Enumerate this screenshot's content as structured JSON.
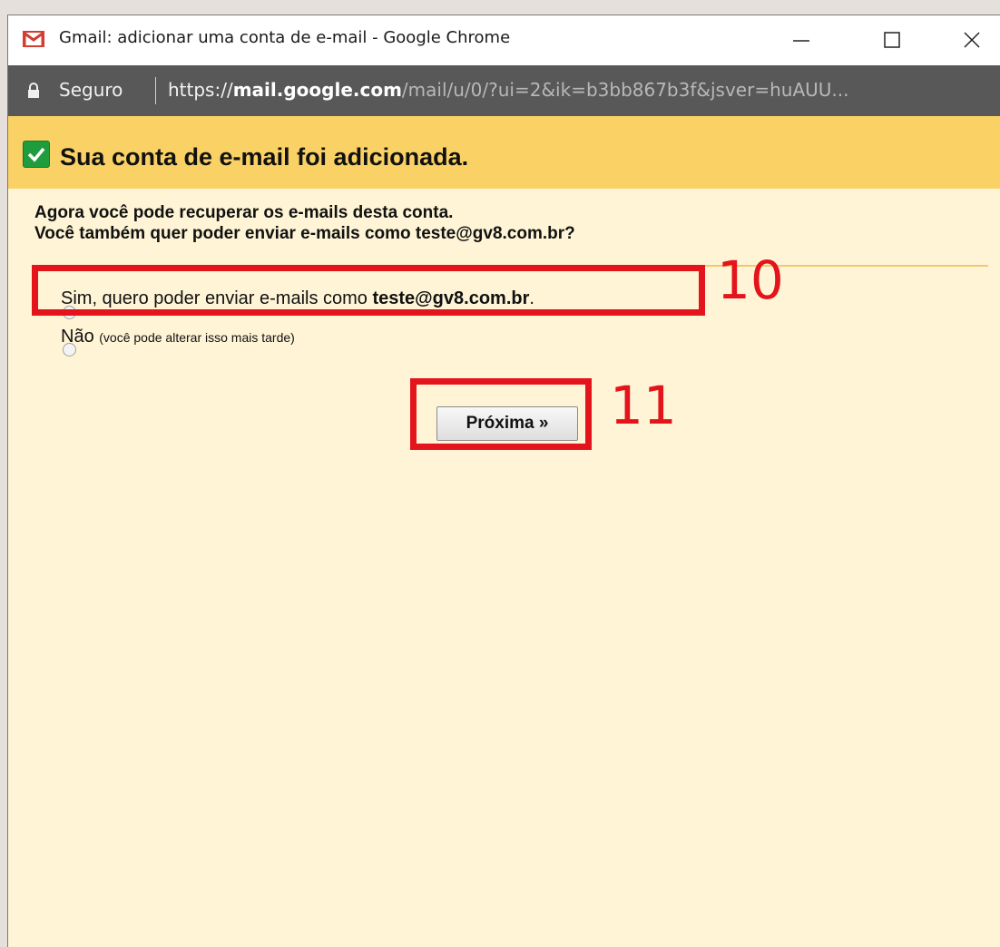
{
  "window": {
    "title": "Gmail: adicionar uma conta de e-mail - Google Chrome",
    "controls": [
      "minimize",
      "maximize",
      "close"
    ]
  },
  "addressbar": {
    "secure_label": "Seguro",
    "url_scheme": "https://",
    "url_host": "mail.google.com",
    "url_path": "/mail/u/0/?ui=2&ik=b3bb867b3f&jsver=huAUU..."
  },
  "banner": {
    "headline": "Sua conta de e-mail foi adicionada."
  },
  "prompt": {
    "line1": "Agora você pode recuperar os e-mails desta conta.",
    "line2": "Você também quer poder enviar e-mails como teste@gv8.com.br?"
  },
  "options": {
    "yes_prefix": "Sim, quero poder enviar e-mails como ",
    "yes_email": "teste@gv8.com.br",
    "yes_suffix": ".",
    "yes_selected": true,
    "no_label": "Não",
    "no_note": "(você pode alterar isso mais tarde)"
  },
  "next_button_label": "Próxima »",
  "annotations": {
    "step_10": "10",
    "step_11": "11"
  },
  "colors": {
    "banner": "#f9d165",
    "content_bg": "#fff5d6",
    "annotation": "#e3141b",
    "addressbar": "#585858",
    "check": "#1f9d3c"
  },
  "icons": [
    "gmail-icon",
    "minimize-icon",
    "maximize-icon",
    "close-icon",
    "lock-icon",
    "check-icon"
  ]
}
